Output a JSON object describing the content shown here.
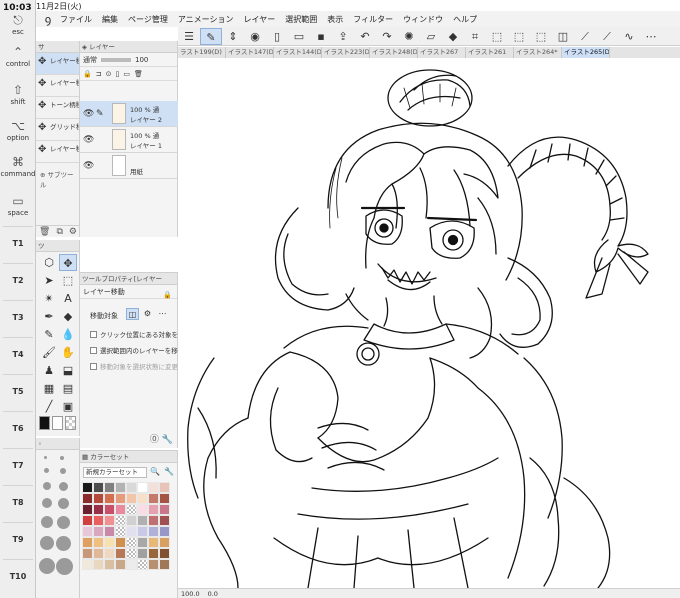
{
  "status": {
    "time": "10:03",
    "date": "11月2日(火)"
  },
  "edge_keys": {
    "esc": "esc",
    "control": "control",
    "shift": "shift",
    "option": "option",
    "command": "command",
    "space": "space",
    "t_keys": [
      "T1",
      "T2",
      "T3",
      "T4",
      "T5",
      "T6",
      "T7",
      "T8",
      "T9",
      "T10"
    ]
  },
  "menu": {
    "items": [
      "ファイル",
      "編集",
      "ページ管理",
      "アニメーション",
      "レイヤー",
      "選択範囲",
      "表示",
      "フィルター",
      "ウィンドウ",
      "ヘルプ"
    ]
  },
  "tabs": [
    "ラスト199(D)",
    "イラスト147(D)",
    "イラスト144(D)",
    "イラスト223(D)",
    "イラスト248(D)",
    "イラスト267",
    "イラスト261",
    "イラスト264*",
    "イラスト265(D)"
  ],
  "subtool": {
    "header": "サ",
    "items": [
      "レイヤー移",
      "レイヤー移",
      "トーン柄移",
      "グリッド移",
      "レイヤー移"
    ],
    "add": "サブツール"
  },
  "layers": {
    "header": "レイヤー",
    "blend": "通常",
    "opacity": "100",
    "rows": [
      {
        "opacity": "100 %",
        "mode": "通",
        "name": "レイヤー 2"
      },
      {
        "opacity": "100 %",
        "mode": "通",
        "name": "レイヤー 1"
      },
      {
        "opacity": "",
        "mode": "",
        "name": "用紙"
      }
    ]
  },
  "tool_property": {
    "header": "ツールプロパティ[レイヤー",
    "tool_name": "レイヤー移動",
    "target_label": "移動対象",
    "options": [
      "クリック位置にある対象を移動",
      "選択範囲内のレイヤーを移動",
      "移動対象を選択状態に変更"
    ]
  },
  "tool_panel": {
    "header": "ツ"
  },
  "color_set": {
    "header": "カラーセット",
    "selected": "新規カラーセット",
    "swatches": [
      "#1a1a1a",
      "#4d4d4d",
      "#808080",
      "#b3b3b3",
      "#d9d9d9",
      "#ffffff",
      "#f4e0d8",
      "#e8c4b8",
      "#8a2c2c",
      "#b34a3a",
      "#d4704f",
      "#e69b7a",
      "#f2c4a8",
      "#f8e0c8",
      "#c47a6a",
      "#a45444",
      "#6b2030",
      "#9a3048",
      "#c85068",
      "#e88aa0",
      "#f4b8c8",
      "#fadce4",
      "#e6a0b0",
      "#c8788a",
      "#d04040",
      "#e86060",
      "#f09090",
      "#f8c0c0",
      "#d0d0d0",
      "#b0b0b0",
      "#c07070",
      "#a05050",
      "#e8c8d8",
      "#d8a8c0",
      "#c888a8",
      "#f0d8e0",
      "#e0e0f0",
      "#c8c8e8",
      "#b0b0d8",
      "#9898c8",
      "#e0a060",
      "#f0c080",
      "#f8e0b0",
      "#d09050",
      "#c0c0c0",
      "#a8a8a8",
      "#e8b878",
      "#d8a060",
      "#c89878",
      "#e0b898",
      "#f0d8c0",
      "#b87858",
      "#d8d8d8",
      "#a0a0a0",
      "#98683c",
      "#805030",
      "#f0e8d8",
      "#e8d8c0",
      "#d8c0a0",
      "#c8a888",
      "#ececec",
      "#f8f8f8",
      "#b89070",
      "#a07858"
    ],
    "checker_indices": [
      20,
      27,
      35,
      44,
      52,
      61
    ]
  },
  "canvas_status": {
    "zoom": "100.0",
    "angle": "0.0"
  },
  "colors": {
    "accent": "#cfe0f5",
    "panel": "#f2f2f2",
    "ink": "#111111"
  }
}
